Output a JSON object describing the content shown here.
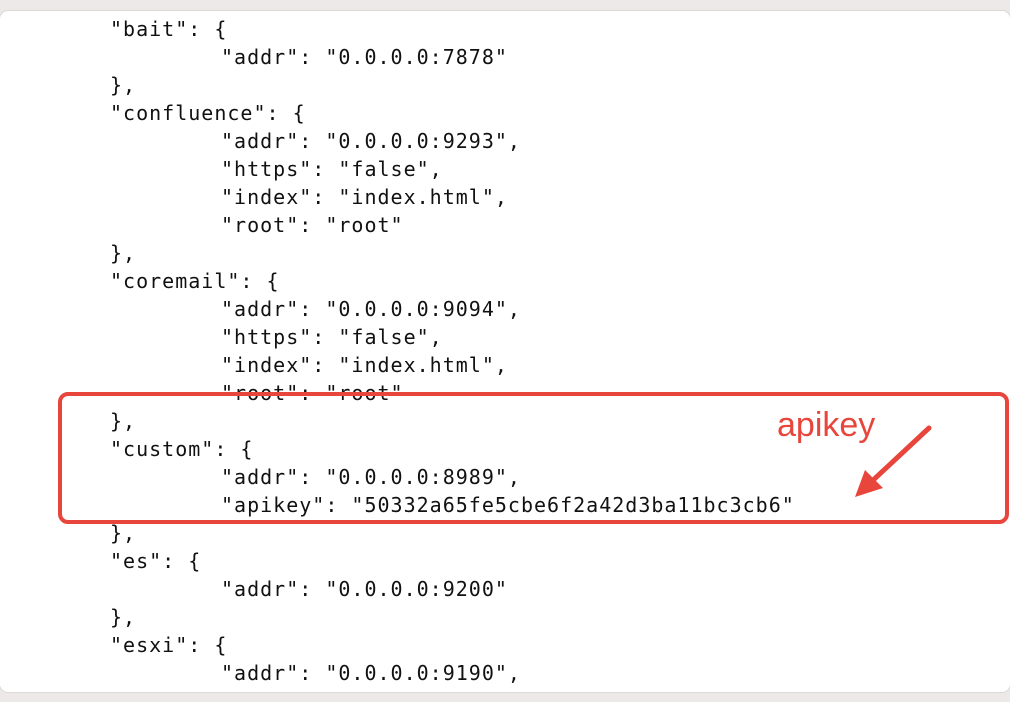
{
  "editor": {
    "lines": [
      "\"bait\": {",
      "\"addr\": \"0.0.0.0:7878\"",
      "},",
      "\"confluence\": {",
      "\"addr\": \"0.0.0.0:9293\",",
      "\"https\": \"false\",",
      "\"index\": \"index.html\",",
      "\"root\": \"root\"",
      "},",
      "\"coremail\": {",
      "\"addr\": \"0.0.0.0:9094\",",
      "\"https\": \"false\",",
      "\"index\": \"index.html\",",
      "\"root\": \"root\"",
      "},",
      "\"custom\": {",
      "\"addr\": \"0.0.0.0:8989\",",
      "\"apikey\": \"50332a65fe5cbe6f2a42d3ba11bc3cb6\"",
      "},",
      "\"es\": {",
      "\"addr\": \"0.0.0.0:9200\"",
      "},",
      "\"esxi\": {",
      "\"addr\": \"0.0.0.0:9190\","
    ]
  },
  "annotation": {
    "label": "apikey",
    "color": "#e8453c"
  }
}
